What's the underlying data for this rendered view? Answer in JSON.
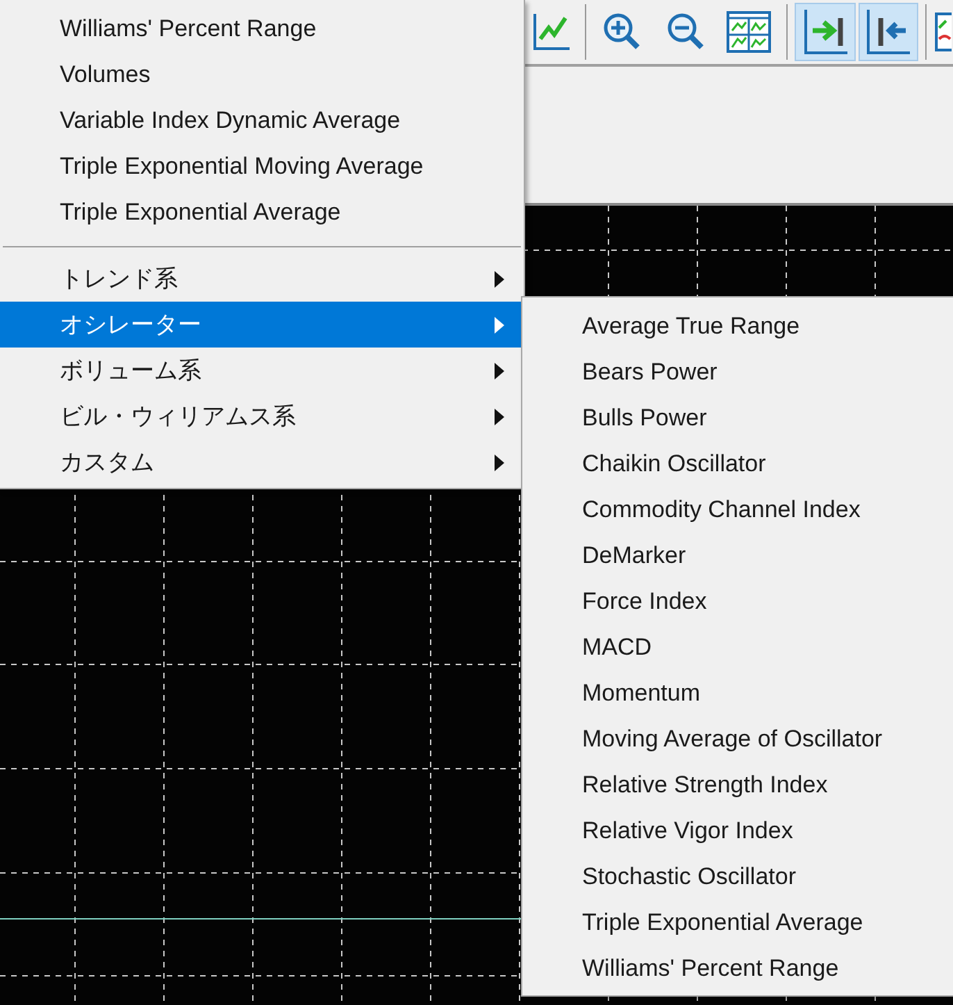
{
  "toolbar": {
    "buttons": [
      {
        "kind": "line-chart",
        "pressed": false
      },
      {
        "kind": "separator"
      },
      {
        "kind": "zoom-in",
        "pressed": false
      },
      {
        "kind": "zoom-out",
        "pressed": false
      },
      {
        "kind": "tile",
        "pressed": false
      },
      {
        "kind": "separator"
      },
      {
        "kind": "scroll-end",
        "pressed": true
      },
      {
        "kind": "shift-end",
        "pressed": true
      },
      {
        "kind": "separator"
      },
      {
        "kind": "templates",
        "pressed": false
      }
    ]
  },
  "menu": {
    "items": [
      {
        "kind": "item",
        "label": "Williams' Percent Range"
      },
      {
        "kind": "item",
        "label": "Volumes"
      },
      {
        "kind": "item",
        "label": "Variable Index Dynamic Average"
      },
      {
        "kind": "item",
        "label": "Triple Exponential Moving Average"
      },
      {
        "kind": "item",
        "label": "Triple Exponential Average"
      },
      {
        "kind": "separator"
      },
      {
        "kind": "submenu",
        "label": "トレンド系",
        "selected": false
      },
      {
        "kind": "submenu",
        "label": "オシレーター",
        "selected": true
      },
      {
        "kind": "submenu",
        "label": "ボリューム系",
        "selected": false
      },
      {
        "kind": "submenu",
        "label": "ビル・ウィリアムス系",
        "selected": false
      },
      {
        "kind": "submenu",
        "label": "カスタム",
        "selected": false
      }
    ]
  },
  "submenu": {
    "items": [
      "Average True Range",
      "Bears Power",
      "Bulls Power",
      "Chaikin Oscillator",
      "Commodity Channel Index",
      "DeMarker",
      "Force Index",
      "MACD",
      "Momentum",
      "Moving Average of Oscillator",
      "Relative Strength Index",
      "Relative Vigor Index",
      "Stochastic Oscillator",
      "Triple Exponential Average",
      "Williams' Percent Range"
    ]
  }
}
